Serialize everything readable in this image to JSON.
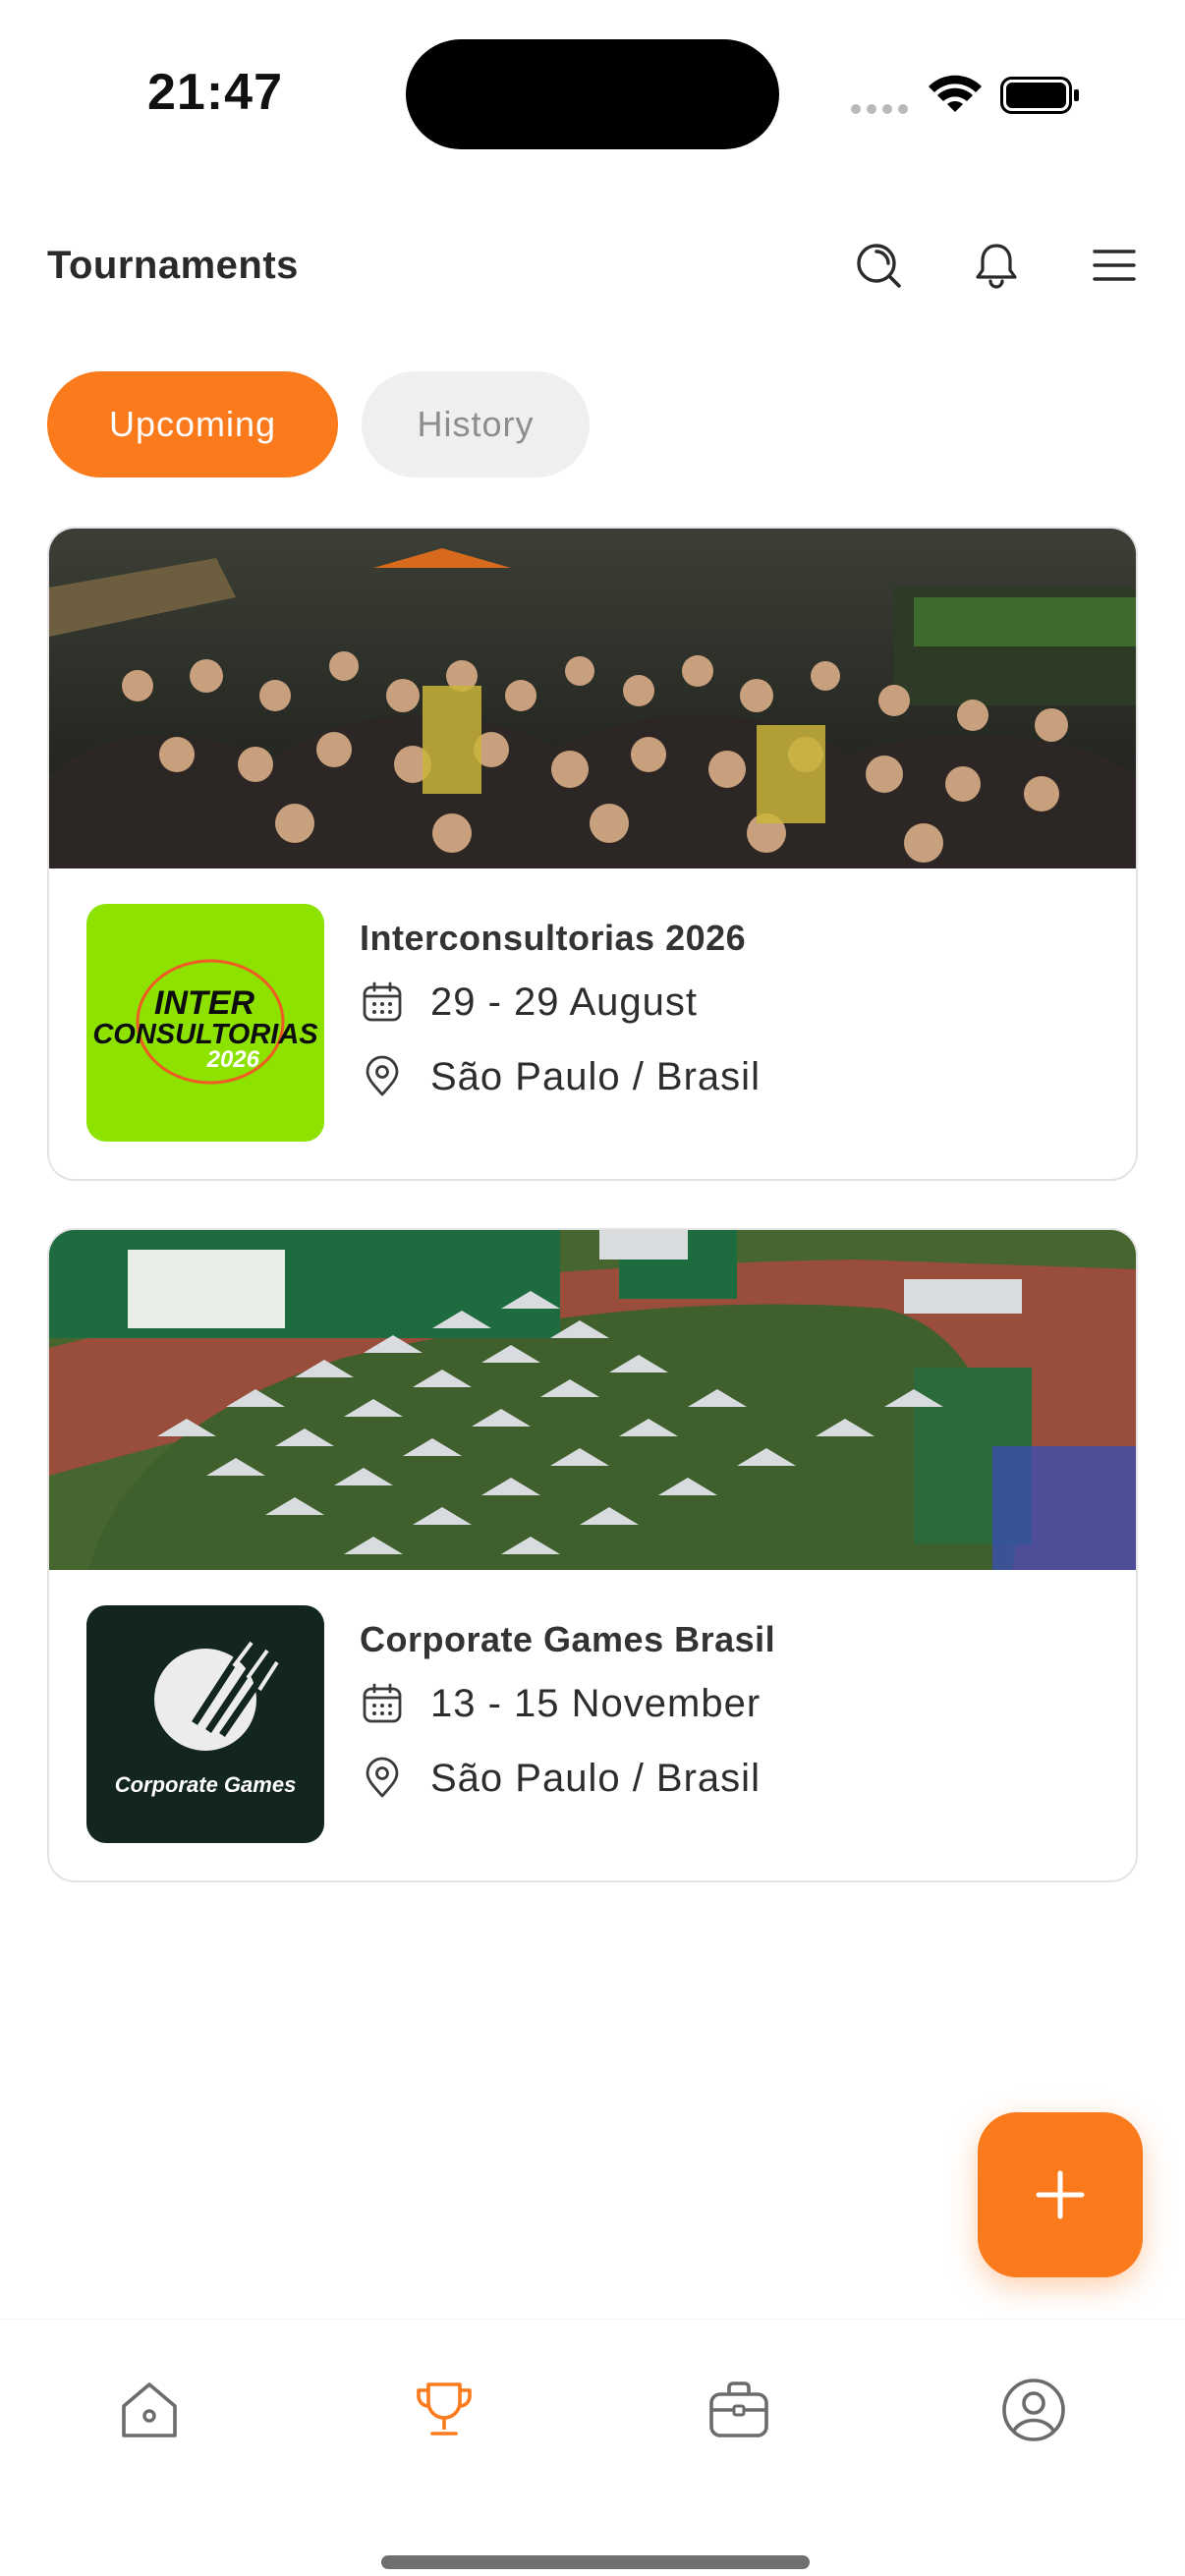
{
  "status_bar": {
    "time": "21:47"
  },
  "header": {
    "title": "Tournaments",
    "search_icon": "search-icon",
    "notifications_icon": "bell-icon",
    "menu_icon": "hamburger-menu-icon"
  },
  "tabs": [
    {
      "label": "Upcoming",
      "active": true
    },
    {
      "label": "History",
      "active": false
    }
  ],
  "tournaments": [
    {
      "name": "Interconsultorias 2026",
      "date": "29 - 29 August",
      "location": "São Paulo / Brasil",
      "logo_lines": [
        "INTER",
        "CONSULTORIAS",
        "2026"
      ],
      "logo_bg": "#8de200"
    },
    {
      "name": "Corporate Games Brasil",
      "date": "13 - 15 November",
      "location": "São Paulo / Brasil",
      "logo_text": "Corporate Games",
      "logo_bg": "#12261d"
    }
  ],
  "bottom_nav": [
    {
      "name": "home",
      "icon": "home-icon",
      "active": false
    },
    {
      "name": "tournaments",
      "icon": "trophy-icon",
      "active": true
    },
    {
      "name": "business",
      "icon": "briefcase-icon",
      "active": false
    },
    {
      "name": "profile",
      "icon": "user-icon",
      "active": false
    }
  ],
  "colors": {
    "accent": "#fb7a1c",
    "inactive_tab_bg": "#efefef",
    "icon_gray": "#6b6b6b"
  }
}
